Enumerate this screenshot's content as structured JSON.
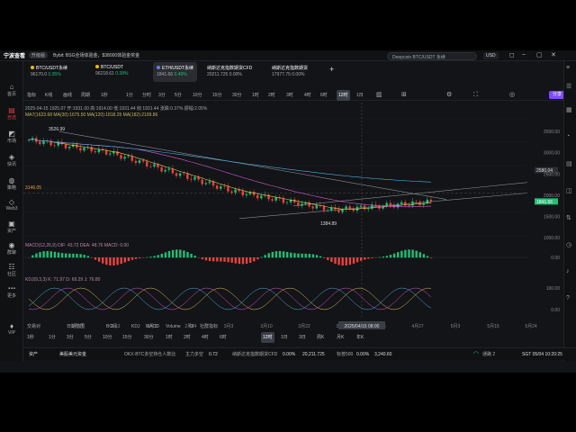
{
  "app": {
    "name": "宁波查看",
    "badge": "升级版",
    "ticker_text": "Bybit: BSG全场体验金，$38000体验金奖金"
  },
  "search": {
    "placeholder": "Deepcoin BTC/USDT 永续"
  },
  "currency": "USD",
  "sidebar": {
    "items": [
      {
        "label": "首页",
        "icon": "home-icon"
      },
      {
        "label": "自选",
        "icon": "star-icon"
      },
      {
        "label": "市场",
        "icon": "chart-icon"
      },
      {
        "label": "快讯",
        "icon": "news-icon"
      },
      {
        "label": "策略",
        "icon": "strategy-icon"
      },
      {
        "label": "Web3",
        "icon": "web3-icon"
      },
      {
        "label": "资产",
        "icon": "wallet-icon"
      },
      {
        "label": "群聊",
        "icon": "chat-icon"
      },
      {
        "label": "社区",
        "icon": "community-icon"
      },
      {
        "label": "更多",
        "icon": "more-icon"
      },
      {
        "label": "VIP",
        "icon": "vip-icon"
      }
    ]
  },
  "tabs": [
    {
      "symbol": "BTC/USDT永续",
      "price": "96170.0",
      "change": "0.35%"
    },
    {
      "symbol": "BTC/USDT",
      "price": "96218.61",
      "change": "0.38%"
    },
    {
      "symbol": "ETH/USDT永续",
      "price": "1841.66",
      "change": "0.49%"
    },
    {
      "symbol": "纳斯达克指数期货CFD",
      "price": "20211.725",
      "change": "0.00%"
    },
    {
      "symbol": "纳斯达克指数期货",
      "price": "17977.75",
      "change": "0.00%"
    }
  ],
  "add_tab": "+",
  "toolbar": {
    "left": [
      "指标",
      "K线",
      "画线",
      "周期"
    ],
    "timeframes": [
      "1秒",
      "1分",
      "分时",
      "3分",
      "5分",
      "10分",
      "15分",
      "30分",
      "1时",
      "2时",
      "3时",
      "4时",
      "6时",
      "12时",
      "1日"
    ],
    "active_timeframe": "12时",
    "share": "分享"
  },
  "chart": {
    "title_line": "2025-04-15 1925.07 开:1931.00 高:1914.00 低:1931.44 收:1931.44 涨跌:0.37% 振幅:2.05%",
    "ma_line": "MA7(1623.68  MA(30):1675.50  MA(120):1818.25  MA(182):2199.86",
    "macd_label": "MACD(12,26,9)  DIF: 43.72  DEA: 48.76  MACD: 0.00",
    "kdj_label": "KDJ(9,3,3)  K: 71.97  D: 69.29  J: 76.80",
    "price_labels": {
      "high": "3526.99",
      "left_mark": "3146.05",
      "low": "1384.89",
      "cursor_date": "2025/04/15 08:00",
      "current_box": "1841.66",
      "upper_box": "2580.04"
    },
    "y_ticks": [
      "3500.00",
      "3000.00",
      "2500.00",
      "2000.00",
      "1500.00",
      "1000.00"
    ],
    "macd_ticks": [
      "0.00"
    ],
    "kdj_ticks": [
      "100.00",
      "0.00"
    ],
    "x_ticks": [
      "1月27",
      "2月3",
      "2月10",
      "2月24",
      "3月3",
      "3月10",
      "3月22",
      "3月31",
      "4月15",
      "4月27",
      "5月3",
      "5月15",
      "5月24"
    ]
  },
  "indicators": [
    "交易对",
    "",
    "日期范围",
    "BOLL",
    "KDJ",
    "MACD",
    "Volume",
    "OI",
    "社群指标"
  ],
  "bottom_timeframes": [
    "1秒",
    "1分",
    "3分",
    "5分",
    "10分",
    "15分",
    "30分",
    "1时",
    "2时",
    "4时",
    "6时",
    "12时",
    "1日",
    "3日",
    "周K",
    "月K",
    "年K"
  ],
  "bottom_active": "12时",
  "status": {
    "assets": "资产",
    "market": "美股美元资金",
    "item1_label": "OKX·BTC多空持仓人数比",
    "item1_value": "0.72",
    "item1_prefix": "主力多空",
    "item2_label": "纳斯达克指数期货CFD",
    "item2_change": "0.00%",
    "item2_value": "20,211.725",
    "item3_label": "标普500",
    "item3_change": "0.00%",
    "item3_value": "3,240.60",
    "network": "通路 2",
    "time": "SGT 05/04 10:20:25"
  },
  "colors": {
    "up": "#1fbf75",
    "down": "#e8443c",
    "accent": "#7b4dff",
    "bg": "#131417"
  }
}
